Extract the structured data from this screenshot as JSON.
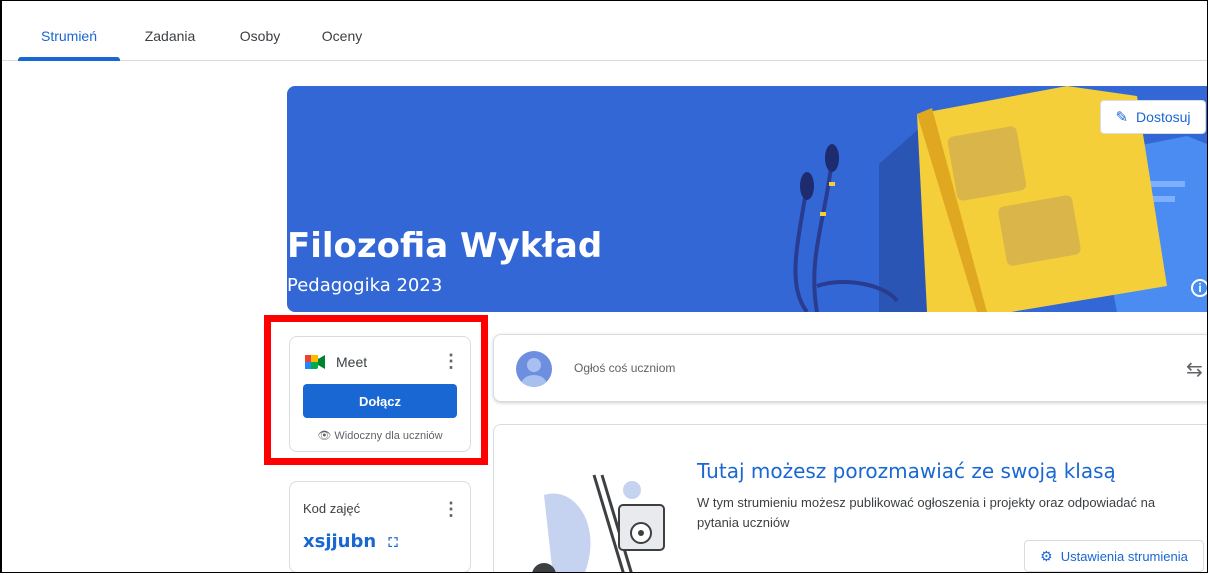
{
  "tabs": [
    {
      "label": "Strumień",
      "active": true
    },
    {
      "label": "Zadania",
      "active": false
    },
    {
      "label": "Osoby",
      "active": false
    },
    {
      "label": "Oceny",
      "active": false
    }
  ],
  "banner": {
    "title": "Filozofia Wykład",
    "subtitle": "Pedagogika 2023",
    "customize_label": "Dostosuj",
    "color": "#3367d6"
  },
  "meet": {
    "label": "Meet",
    "join_label": "Dołącz",
    "visibility_label": "Widoczny dla uczniów"
  },
  "class_code": {
    "title": "Kod zajęć",
    "value": "xsjjubn"
  },
  "announce": {
    "placeholder": "Ogłoś coś uczniom"
  },
  "welcome": {
    "title": "Tutaj możesz porozmawiać ze swoją klasą",
    "description": "W tym strumieniu możesz publikować ogłoszenia i projekty oraz odpowiadać na pytania uczniów",
    "settings_label": "Ustawienia strumienia"
  },
  "colors": {
    "accent": "#1967d2",
    "highlight": "#ff0000"
  }
}
